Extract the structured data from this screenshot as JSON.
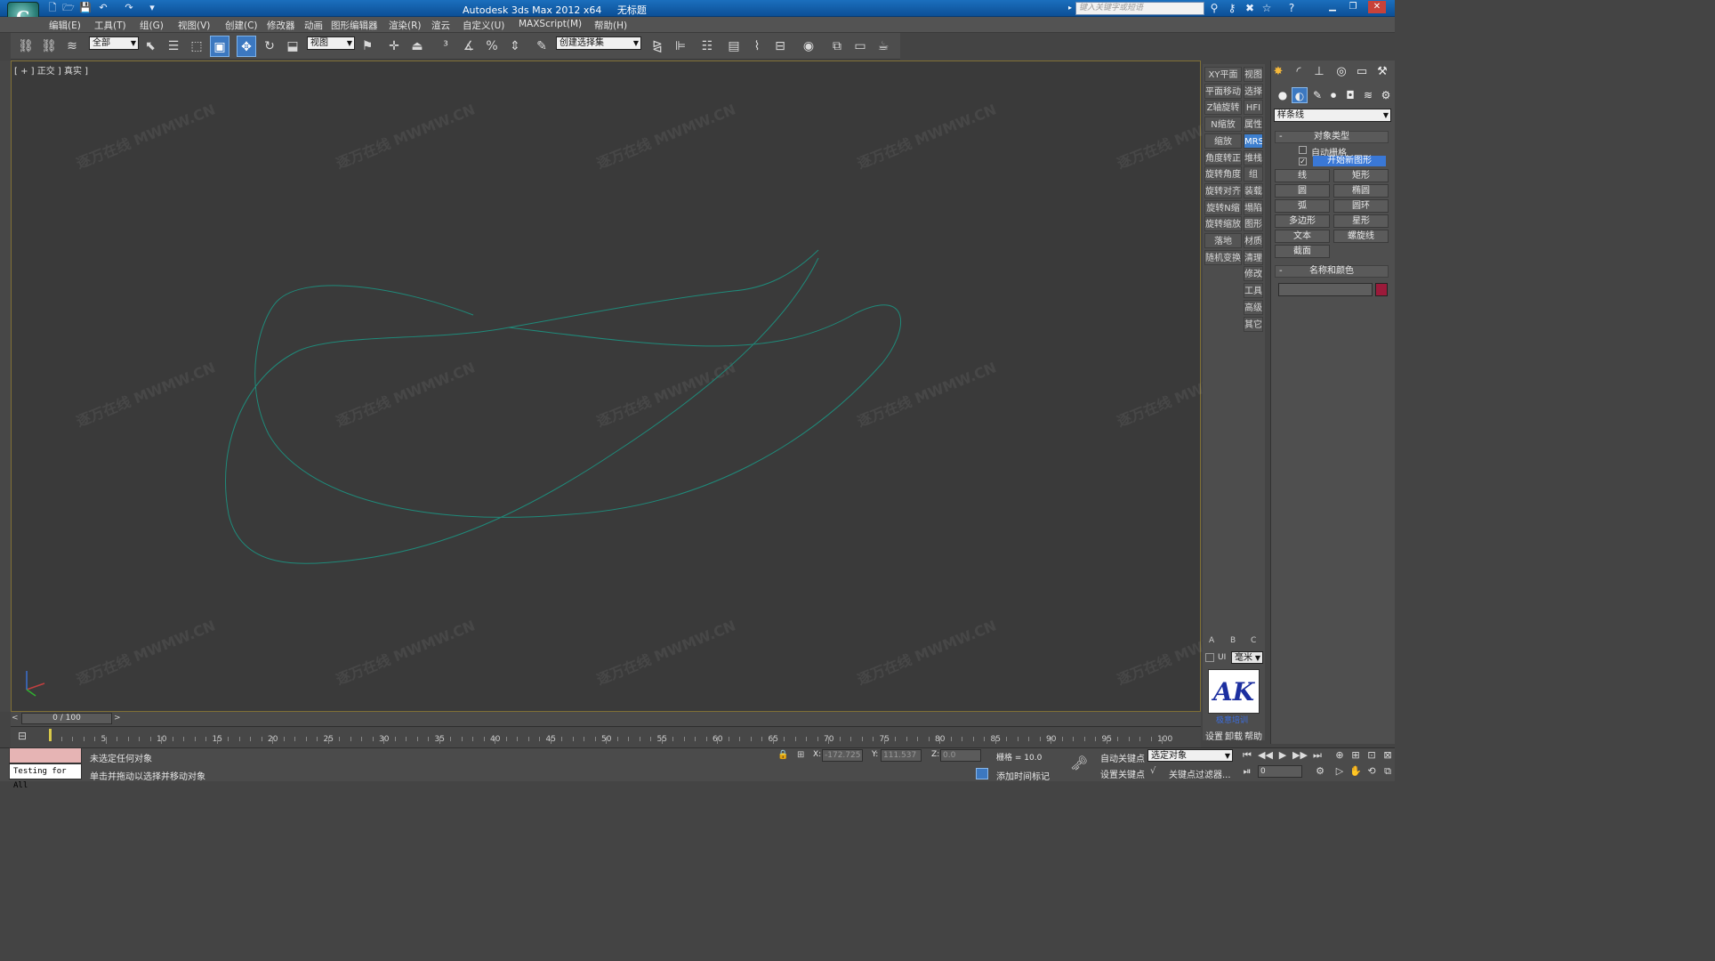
{
  "window": {
    "app_title": "Autodesk 3ds Max  2012 x64",
    "doc_title": "无标题",
    "logo_letter": "G",
    "search_placeholder": "键入关键字或短语"
  },
  "menus": [
    "编辑(E)",
    "工具(T)",
    "组(G)",
    "视图(V)",
    "创建(C)",
    "修改器",
    "动画",
    "图形编辑器",
    "渲染(R)",
    "渲云",
    "自定义(U)",
    "MAXScript(M)",
    "帮助(H)"
  ],
  "toolbar": {
    "selection_filter": "全部",
    "ref_coord": "视图",
    "named_selection": "创建选择集"
  },
  "viewport": {
    "label": "[ + ] 正交 ] 真实 ]",
    "watermark": "MWMW.CN",
    "watermark_prefix": "逐万在线"
  },
  "side_left": [
    "XY平面",
    "平面移动",
    "Z轴旋转",
    "N缩放",
    "缩放",
    "角度转正",
    "旋转角度",
    "旋转对齐",
    "旋转N缩",
    "旋转缩放",
    "落地",
    "随机变换"
  ],
  "side_right": [
    "视图",
    "选择",
    "HFI",
    "属性",
    "MRS",
    "堆栈",
    "组",
    "装载",
    "塌陷",
    "图形",
    "材质",
    "清理",
    "修改",
    "工具",
    "高级",
    "其它"
  ],
  "side_bottom": {
    "a": "A",
    "b": "B",
    "c": "C",
    "ui_label": "UI",
    "unit": "毫米",
    "logo_text": "AK",
    "logo_caption": "极意培训",
    "settings": "设置",
    "uninstall": "卸载",
    "help": "帮助"
  },
  "command_panel": {
    "category": "样条线",
    "object_type_header": "对象类型",
    "auto_grid": "自动栅格",
    "start_new_shape": "开始新图形",
    "buttons": [
      "线",
      "矩形",
      "圆",
      "椭圆",
      "弧",
      "圆环",
      "多边形",
      "星形",
      "文本",
      "螺旋线",
      "截面"
    ],
    "name_color_header": "名称和颜色",
    "object_color": "#9b1a3a",
    "name_value": ""
  },
  "timeline": {
    "slider": "0 / 100",
    "ticks": [
      "5",
      "10",
      "15",
      "20",
      "25",
      "30",
      "35",
      "40",
      "45",
      "50",
      "55",
      "60",
      "65",
      "70",
      "75",
      "80",
      "85",
      "90",
      "95",
      "100"
    ]
  },
  "status": {
    "listener_text": "Testing for All",
    "line1": "未选定任何对象",
    "line2": "单击并拖动以选择并移动对象",
    "x_label": "X:",
    "x_value": "-172.725",
    "y_label": "Y:",
    "y_value": "111.537",
    "z_label": "Z:",
    "z_value": "0.0",
    "grid": "栅格 = 10.0",
    "add_time_tag": "添加时间标记",
    "auto_key": "自动关键点",
    "set_key": "设置关键点",
    "key_mode_select": "选定对象",
    "key_filters": "关键点过滤器...",
    "frame": "0"
  },
  "colors": {
    "spline": "#1f8a7a",
    "viewport_bg": "#3a3a3a",
    "active_blue": "#3c78c0"
  }
}
